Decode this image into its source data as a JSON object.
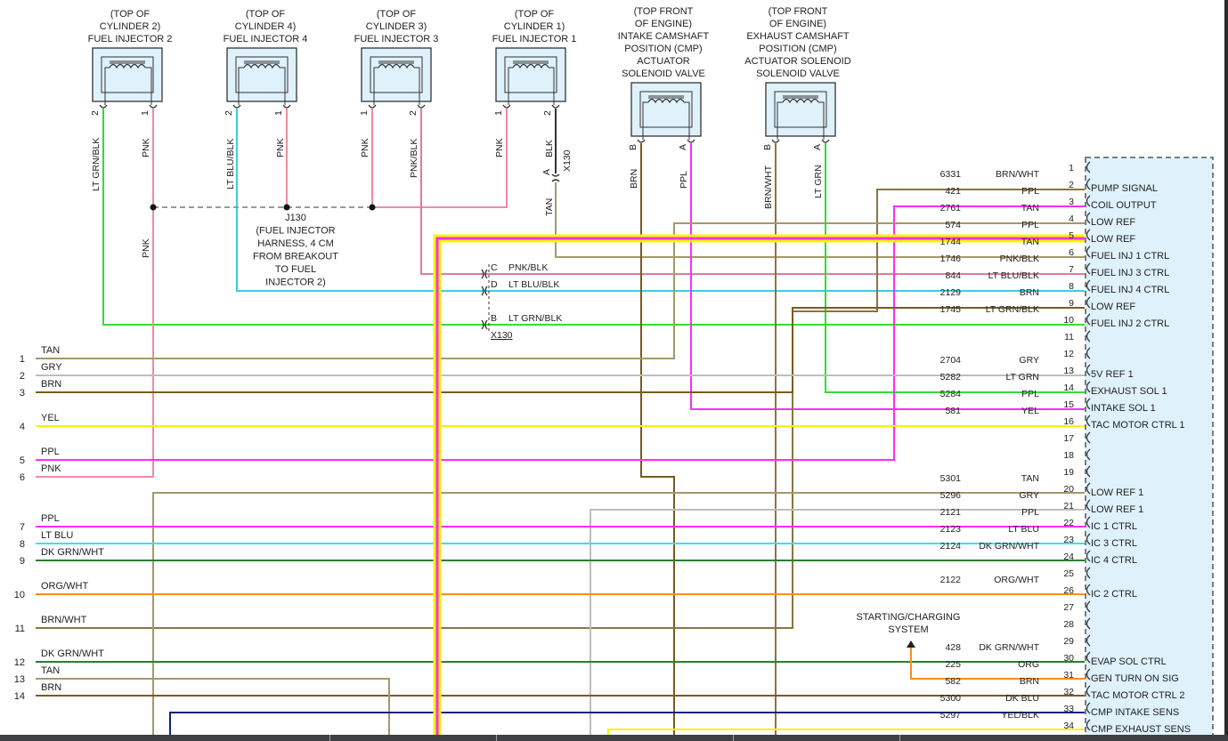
{
  "colors": {
    "TAN": "#a4986c",
    "GRY": "#bdbdbd",
    "BRN": "#7a5a1e",
    "YEL": "#f5f500",
    "PPL": "#ff2cf5",
    "PNK": "#f28aa3",
    "LTBLU": "#38e0f0",
    "DKGRN": "#2d7d2d",
    "ORG": "#ff8c1a",
    "LTGRN": "#33dd33",
    "DKBLU": "#12207a",
    "BLK": "#333333",
    "BRNWHT": "#8a7442",
    "PNKBLK": "#e07a98",
    "LTBLUBLK": "#38d0e0"
  },
  "components": [
    {
      "id": "inj2",
      "lines": [
        "(TOP OF",
        "CYLINDER 2)",
        "FUEL INJECTOR 2"
      ],
      "pins": [
        "2",
        "1"
      ]
    },
    {
      "id": "inj4",
      "lines": [
        "(TOP OF",
        "CYLINDER 4)",
        "FUEL INJECTOR 4"
      ],
      "pins": [
        "2",
        "1"
      ]
    },
    {
      "id": "inj3",
      "lines": [
        "(TOP OF",
        "CYLINDER 3)",
        "FUEL INJECTOR 3"
      ],
      "pins": [
        "1",
        "2"
      ]
    },
    {
      "id": "inj1",
      "lines": [
        "(TOP OF",
        "CYLINDER 1)",
        "FUEL INJECTOR 1"
      ],
      "pins": [
        "1",
        "2"
      ]
    },
    {
      "id": "cmp_int",
      "lines": [
        "(TOP FRONT",
        "OF ENGINE)",
        "INTAKE CAMSHAFT",
        "POSITION (CMP)",
        "ACTUATOR",
        "SOLENOID VALVE"
      ],
      "pins": [
        "B",
        "A"
      ]
    },
    {
      "id": "cmp_exh",
      "lines": [
        "(TOP FRONT",
        "OF ENGINE)",
        "EXHAUST CAMSHAFT",
        "POSITION (CMP)",
        "ACTUATOR SOLENOID",
        "SOLENOID VALVE"
      ],
      "pins": [
        "B",
        "A"
      ]
    }
  ],
  "vertical_labels": [
    {
      "text": "LT GRN/BLK",
      "color": "LTGRN"
    },
    {
      "text": "PNK",
      "color": "PNK"
    },
    {
      "text": "PNK",
      "color": "PNK"
    },
    {
      "text": "LT BLU/BLK",
      "color": "LTBLU"
    },
    {
      "text": "PNK",
      "color": "PNK"
    },
    {
      "text": "PNK",
      "color": "PNK"
    },
    {
      "text": "PNK/BLK",
      "color": "PNK"
    },
    {
      "text": "PNK",
      "color": "PNK"
    },
    {
      "text": "BLK",
      "color": "BLK"
    },
    {
      "text": "TAN",
      "color": "TAN"
    },
    {
      "text": "BRN",
      "color": "BRN"
    },
    {
      "text": "PPL",
      "color": "PPL"
    },
    {
      "text": "BRN/WHT",
      "color": "BRNWHT"
    },
    {
      "text": "LT GRN",
      "color": "LTGRN"
    }
  ],
  "splice": {
    "id": "J130",
    "lines": [
      "J130",
      "(FUEL INJECTOR",
      "HARNESS, 4 CM",
      "FROM BREAKOUT",
      "TO FUEL",
      "INJECTOR 2)"
    ]
  },
  "connector_x130": {
    "name": "X130",
    "pins": [
      {
        "pin": "A",
        "color": "TAN"
      },
      {
        "pin": "C",
        "color": "PNK/BLK"
      },
      {
        "pin": "D",
        "color": "LT BLU/BLK"
      },
      {
        "pin": "B",
        "color": "LT GRN/BLK"
      }
    ]
  },
  "left_connector": [
    {
      "pin": "1",
      "color": "TAN"
    },
    {
      "pin": "2",
      "color": "GRY"
    },
    {
      "pin": "3",
      "color": "BRN"
    },
    {
      "pin": "4",
      "color": "YEL"
    },
    {
      "pin": "5",
      "color": "PPL"
    },
    {
      "pin": "6",
      "color": "PNK"
    },
    {
      "pin": "7",
      "color": "PPL"
    },
    {
      "pin": "8",
      "color": "LT BLU"
    },
    {
      "pin": "9",
      "color": "DK GRN/WHT"
    },
    {
      "pin": "10",
      "color": "ORG/WHT"
    },
    {
      "pin": "11",
      "color": "BRN/WHT"
    },
    {
      "pin": "12",
      "color": "DK GRN/WHT"
    },
    {
      "pin": "13",
      "color": "TAN"
    },
    {
      "pin": "14",
      "color": "BRN"
    }
  ],
  "ecm_pins": [
    {
      "pin": "1",
      "circuit": "",
      "color": "",
      "func": ""
    },
    {
      "pin": "2",
      "circuit": "6331",
      "color": "BRN/WHT",
      "func": "PUMP SIGNAL"
    },
    {
      "pin": "3",
      "circuit": "421",
      "color": "PPL",
      "func": "COIL OUTPUT"
    },
    {
      "pin": "4",
      "circuit": "2761",
      "color": "TAN",
      "func": "LOW REF"
    },
    {
      "pin": "5",
      "circuit": "574",
      "color": "PPL",
      "func": "LOW REF"
    },
    {
      "pin": "6",
      "circuit": "1744",
      "color": "TAN",
      "func": "FUEL INJ 1 CTRL"
    },
    {
      "pin": "7",
      "circuit": "1746",
      "color": "PNK/BLK",
      "func": "FUEL INJ 3 CTRL"
    },
    {
      "pin": "8",
      "circuit": "844",
      "color": "LT BLU/BLK",
      "func": "FUEL INJ 4 CTRL"
    },
    {
      "pin": "9",
      "circuit": "2129",
      "color": "BRN",
      "func": "LOW REF"
    },
    {
      "pin": "10",
      "circuit": "1745",
      "color": "LT GRN/BLK",
      "func": "FUEL INJ 2 CTRL"
    },
    {
      "pin": "11",
      "circuit": "",
      "color": "",
      "func": ""
    },
    {
      "pin": "12",
      "circuit": "",
      "color": "",
      "func": ""
    },
    {
      "pin": "13",
      "circuit": "2704",
      "color": "GRY",
      "func": "5V REF 1"
    },
    {
      "pin": "14",
      "circuit": "5282",
      "color": "LT GRN",
      "func": "EXHAUST SOL 1"
    },
    {
      "pin": "15",
      "circuit": "5284",
      "color": "PPL",
      "func": "INTAKE SOL 1"
    },
    {
      "pin": "16",
      "circuit": "581",
      "color": "YEL",
      "func": "TAC MOTOR CTRL 1"
    },
    {
      "pin": "17",
      "circuit": "",
      "color": "",
      "func": ""
    },
    {
      "pin": "18",
      "circuit": "",
      "color": "",
      "func": ""
    },
    {
      "pin": "19",
      "circuit": "",
      "color": "",
      "func": ""
    },
    {
      "pin": "20",
      "circuit": "5301",
      "color": "TAN",
      "func": "LOW REF 1"
    },
    {
      "pin": "21",
      "circuit": "5296",
      "color": "GRY",
      "func": "LOW REF 1"
    },
    {
      "pin": "22",
      "circuit": "2121",
      "color": "PPL",
      "func": "IC 1 CTRL"
    },
    {
      "pin": "23",
      "circuit": "2123",
      "color": "LT BLU",
      "func": "IC 3 CTRL"
    },
    {
      "pin": "24",
      "circuit": "2124",
      "color": "DK GRN/WHT",
      "func": "IC 4 CTRL"
    },
    {
      "pin": "25",
      "circuit": "",
      "color": "",
      "func": ""
    },
    {
      "pin": "26",
      "circuit": "2122",
      "color": "ORG/WHT",
      "func": "IC 2 CTRL"
    },
    {
      "pin": "27",
      "circuit": "",
      "color": "",
      "func": ""
    },
    {
      "pin": "28",
      "circuit": "",
      "color": "",
      "func": ""
    },
    {
      "pin": "29",
      "circuit": "",
      "color": "",
      "func": ""
    },
    {
      "pin": "30",
      "circuit": "428",
      "color": "DK GRN/WHT",
      "func": "EVAP SOL CTRL"
    },
    {
      "pin": "31",
      "circuit": "225",
      "color": "ORG",
      "func": "GEN TURN ON SIG"
    },
    {
      "pin": "32",
      "circuit": "582",
      "color": "BRN",
      "func": "TAC MOTOR CTRL 2"
    },
    {
      "pin": "33",
      "circuit": "5300",
      "color": "DK BLU",
      "func": "CMP INTAKE SENS"
    },
    {
      "pin": "34",
      "circuit": "5297",
      "color": "YEL/BLK",
      "func": "CMP EXHAUST SENS"
    }
  ],
  "starting_charging": {
    "lines": [
      "STARTING/CHARGING",
      "SYSTEM"
    ]
  }
}
